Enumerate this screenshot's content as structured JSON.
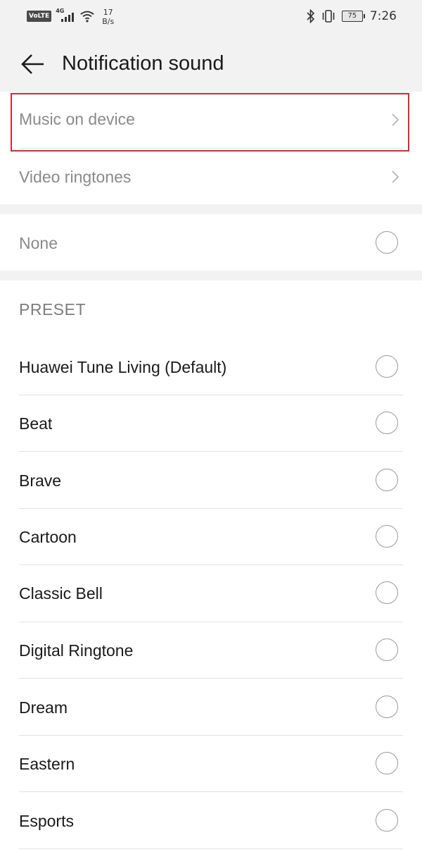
{
  "status_bar": {
    "volte": "VoLTE",
    "network": "4G",
    "speed_value": "17",
    "speed_unit": "B/s",
    "battery": "75",
    "time": "7:26"
  },
  "header": {
    "title": "Notification sound"
  },
  "sources": [
    {
      "label": "Music on device"
    },
    {
      "label": "Video ringtones"
    }
  ],
  "none_option": {
    "label": "None"
  },
  "preset": {
    "title": "PRESET",
    "items": [
      {
        "label": "Huawei Tune Living (Default)"
      },
      {
        "label": "Beat"
      },
      {
        "label": "Brave"
      },
      {
        "label": "Cartoon"
      },
      {
        "label": "Classic Bell"
      },
      {
        "label": "Digital Ringtone"
      },
      {
        "label": "Dream"
      },
      {
        "label": "Eastern"
      },
      {
        "label": "Esports"
      }
    ]
  },
  "colors": {
    "background": "#f2f2f2",
    "card": "#ffffff",
    "highlight": "#d42a35"
  }
}
